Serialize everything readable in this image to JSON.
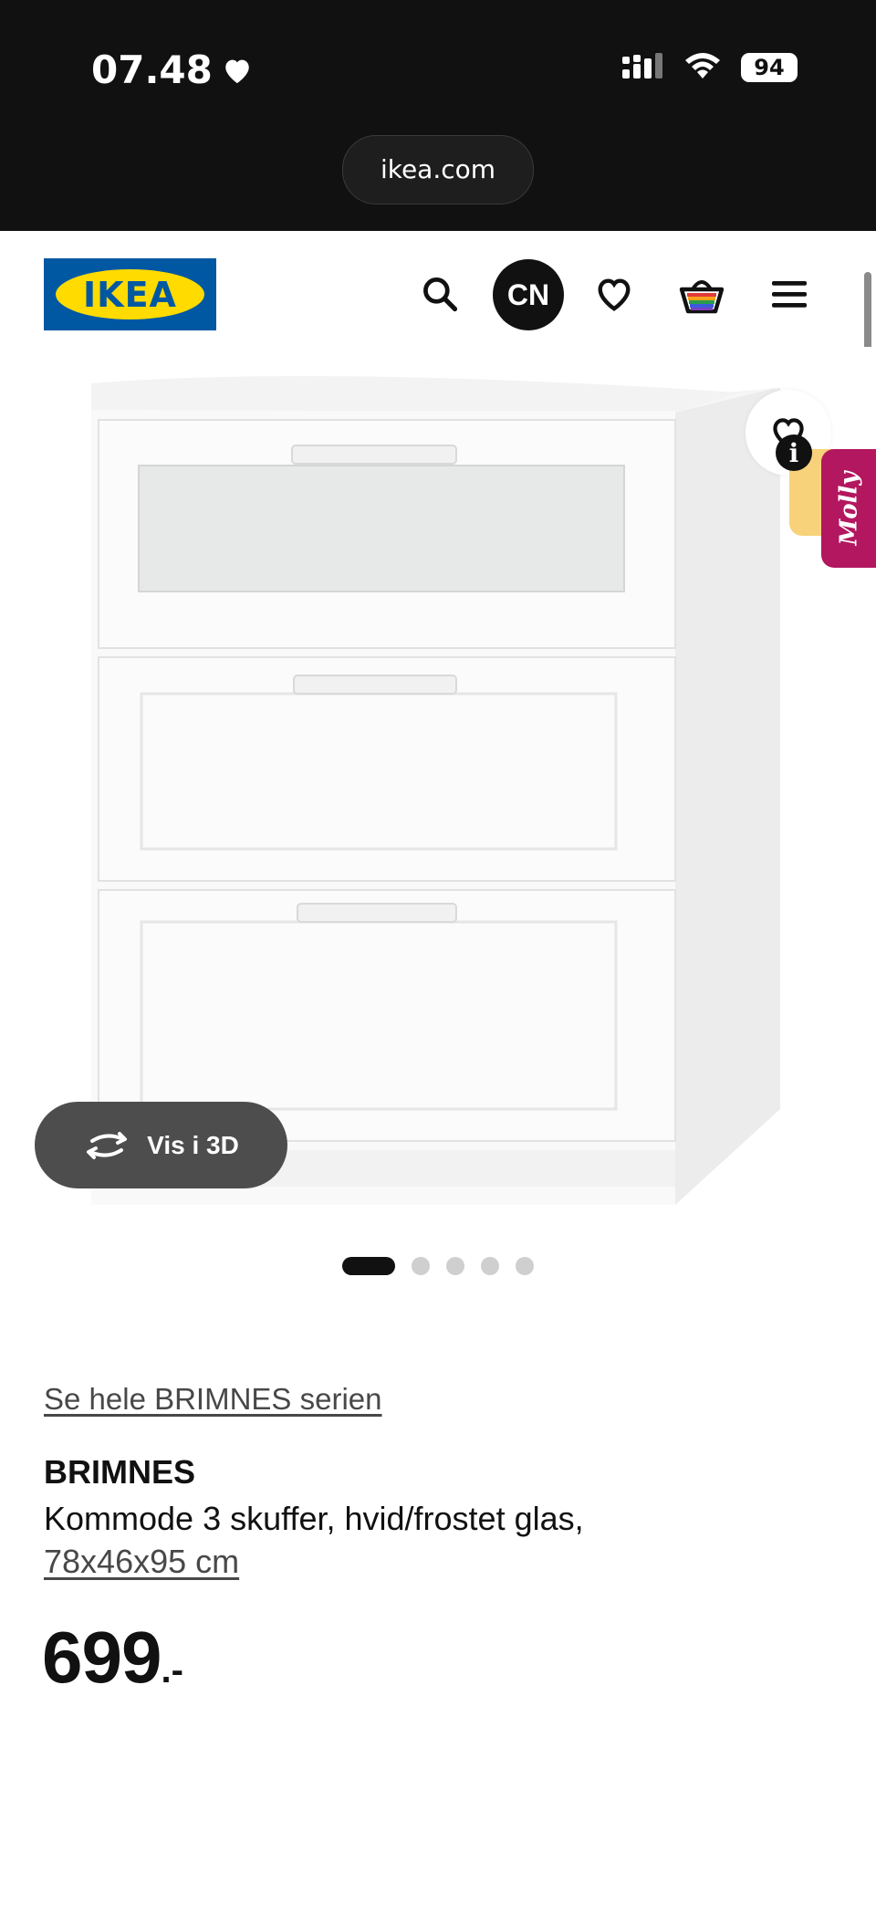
{
  "status_bar": {
    "time": "07.48",
    "battery": "94"
  },
  "browser": {
    "url": "ikea.com"
  },
  "header": {
    "logo_text": "IKEA",
    "profile_initials": "CN",
    "icons": [
      "search-icon",
      "heart-icon",
      "basket-icon",
      "menu-icon"
    ]
  },
  "gallery": {
    "view_3d_label": "Vis i 3D",
    "dot_count": 5,
    "active_dot": 0,
    "chat_widget_label": "Molly"
  },
  "product": {
    "series_link": "Se hele BRIMNES serien",
    "name": "BRIMNES",
    "description": "Kommode 3 skuffer, hvid/frostet glas,",
    "size": "78x46x95 cm",
    "price": "699",
    "price_suffix": ".-"
  },
  "colors": {
    "ikea_blue": "#0058a3",
    "ikea_yellow": "#ffdb00",
    "molly_magenta": "#b3175f"
  }
}
